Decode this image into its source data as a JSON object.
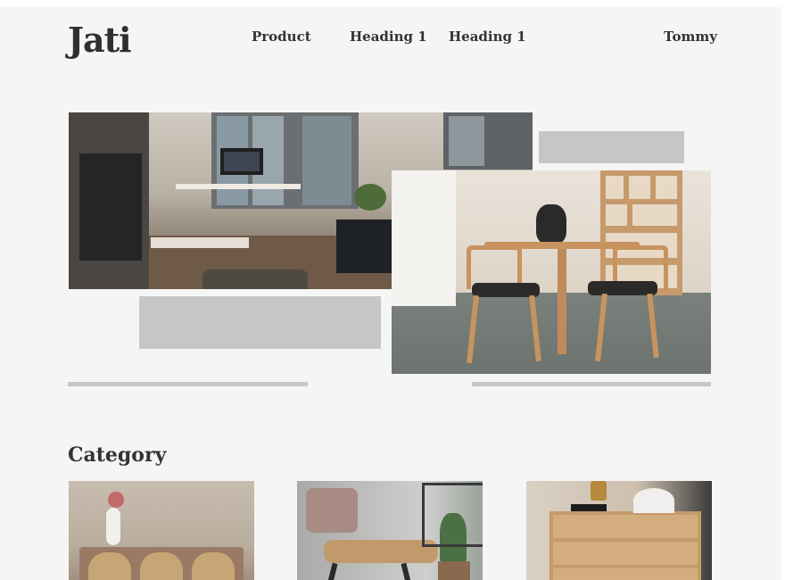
{
  "header": {
    "logo": "Jati",
    "nav": [
      {
        "label": "Product"
      },
      {
        "label": "Heading 1"
      },
      {
        "label": "Heading 1"
      }
    ],
    "user": "Tommy"
  },
  "hero": {
    "image_1": "office-workspace-photo",
    "image_2": "dining-room-photo"
  },
  "category": {
    "title": "Category",
    "cards": [
      {
        "image": "sideboard-cabinet-photo"
      },
      {
        "image": "lounge-chair-photo"
      },
      {
        "image": "wooden-dresser-photo"
      }
    ]
  }
}
